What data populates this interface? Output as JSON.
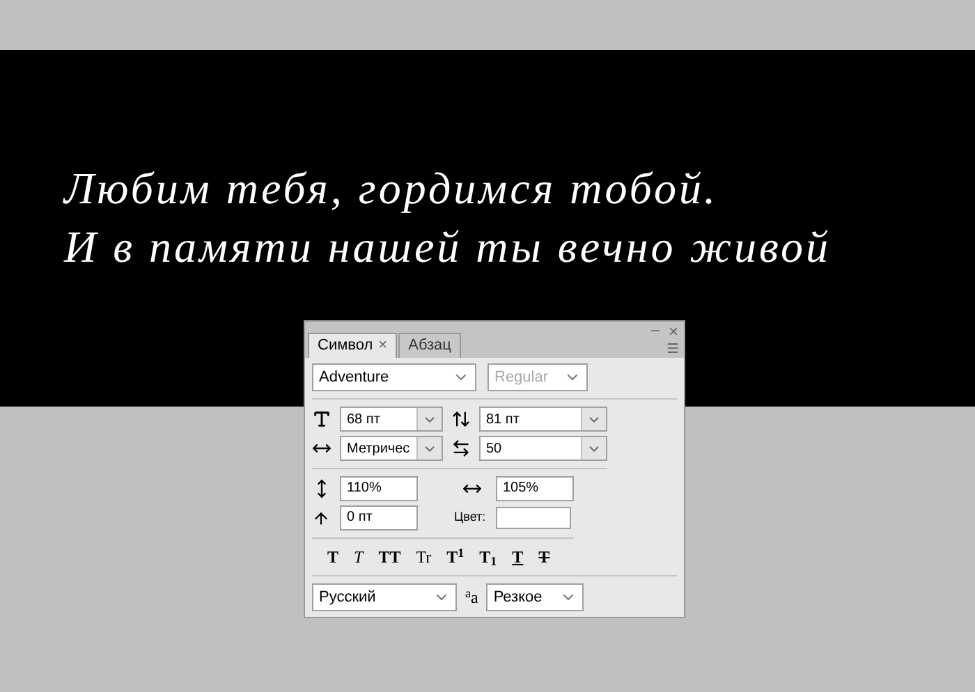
{
  "canvas": {
    "lines": [
      "Любим тебя, гордимся тобой.",
      "И в памяти нашей ты вечно живой"
    ]
  },
  "panel": {
    "tabs": [
      {
        "label": "Символ",
        "selected": true,
        "closable": true
      },
      {
        "label": "Абзац",
        "selected": false,
        "closable": false
      }
    ],
    "close_glyph": "×",
    "font_family": {
      "value": "Adventure",
      "disabled": false
    },
    "font_style": {
      "value": "Regular",
      "disabled": true
    },
    "font_size": {
      "value": "68 пт"
    },
    "leading": {
      "value": "81 пт"
    },
    "kerning": {
      "value": "Метричес"
    },
    "tracking": {
      "value": "50"
    },
    "vertical_scale": {
      "value": "110%"
    },
    "horizontal_scale": {
      "value": "105%"
    },
    "baseline_shift": {
      "value": "0 пт"
    },
    "color_label": "Цвет:",
    "style_buttons": [
      {
        "kind": "bold",
        "label": "T"
      },
      {
        "kind": "italic",
        "label": "T"
      },
      {
        "kind": "allcaps",
        "label": "TT"
      },
      {
        "kind": "smallcaps",
        "label": "Tr"
      },
      {
        "kind": "superscript",
        "label": "T$^{1}$"
      },
      {
        "kind": "subscript",
        "label": "T$_{1}$"
      },
      {
        "kind": "underline",
        "label": "T"
      },
      {
        "kind": "strikethrough",
        "label": "T"
      }
    ],
    "language": {
      "value": "Русский"
    },
    "antialias_glyph": "$^{a}$a",
    "antialias": {
      "value": "Резкое"
    }
  }
}
